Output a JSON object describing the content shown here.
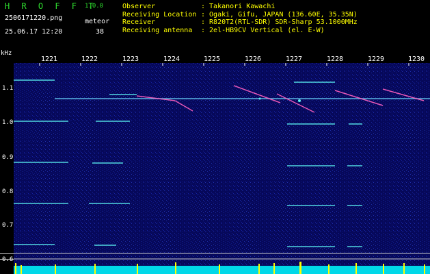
{
  "header": {
    "app_title": "H R O F F T",
    "version": "1.0.0",
    "filename": "2506171220.png",
    "datetime": "25.06.17 12:20",
    "meteor_label": "meteor",
    "meteor_count": "38",
    "info": [
      {
        "key": "Observer",
        "value": ": Takanori Kawachi"
      },
      {
        "key": "Receiving Location",
        "value": ": Ogaki, Gifu, JAPAN (136.60E, 35.35N)"
      },
      {
        "key": "Receiver",
        "value": ": R820T2(RTL-SDR) SDR-Sharp 53.1000MHz"
      },
      {
        "key": "Receiving antenna",
        "value": ": 2el-HB9CV Vertical (el. E-W)"
      }
    ]
  },
  "axis": {
    "unit": "kHz",
    "time_ticks": [
      "1221",
      "1222",
      "1223",
      "1224",
      "1225",
      "1226",
      "1227",
      "1228",
      "1229",
      "1230"
    ],
    "freq_ticks": [
      "1.1",
      "1.0",
      "0.9",
      "0.8",
      "0.7",
      "0.6"
    ]
  },
  "colors": {
    "background": "#06085a",
    "signal": "#5af0f0",
    "meteor": "#ff60c0",
    "histogram": "#ffff00",
    "noise": "#00e0e0"
  }
}
